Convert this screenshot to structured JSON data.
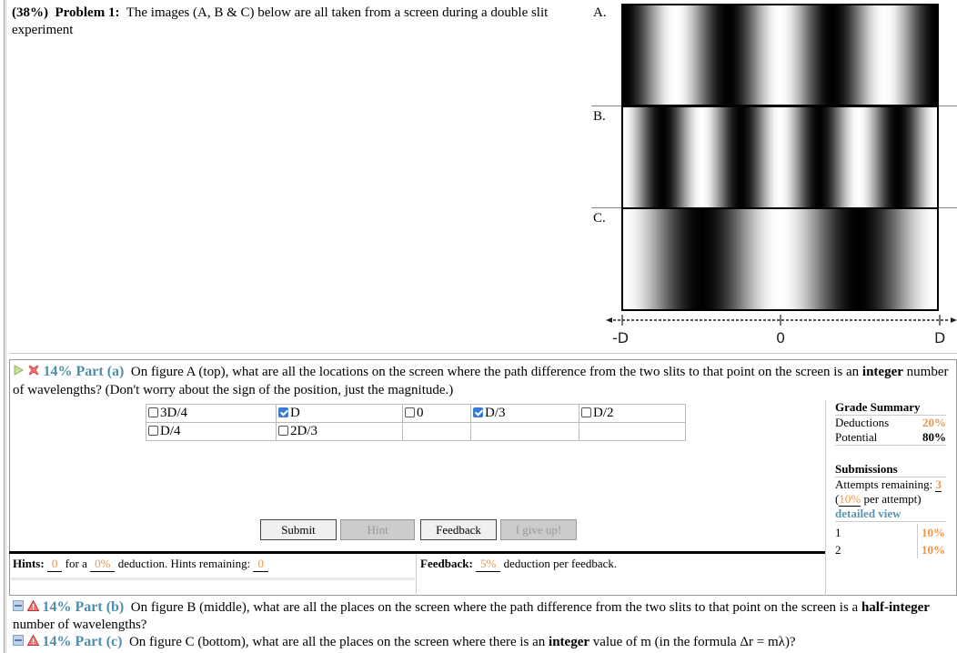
{
  "problem": {
    "percent": "(38%)",
    "title": "Problem 1:",
    "text": "The images (A, B & C) below are all taken from a screen during a double slit experiment"
  },
  "figure": {
    "labels": [
      "A.",
      "B.",
      "C."
    ],
    "axis_labels": [
      "-D",
      "0",
      "D"
    ]
  },
  "part_a": {
    "percent": "14% Part (a)",
    "text1": "On figure A (top), what are all the locations on the screen where the path difference from the two slits to that point on the screen is an",
    "bold": "integer",
    "text2": "number of wavelengths? (Don't worry about the sign of the position, just the magnitude.)",
    "status_icon": "x-mark-icon",
    "choices": [
      {
        "label": "3D/4",
        "checked": false
      },
      {
        "label": "D",
        "checked": true
      },
      {
        "label": "0",
        "checked": false
      },
      {
        "label": "D/3",
        "checked": true
      },
      {
        "label": "D/2",
        "checked": false
      },
      {
        "label": "D/4",
        "checked": false
      },
      {
        "label": "2D/3",
        "checked": false
      }
    ],
    "buttons": {
      "submit": "Submit",
      "hint": "Hint",
      "feedback": "Feedback",
      "give_up": "I give up!"
    },
    "hints": {
      "label": "Hints:",
      "count": "0",
      "mid": "for a",
      "deduction": "0%",
      "tail": "deduction. Hints remaining:",
      "remaining": "0"
    },
    "feedback": {
      "label": "Feedback:",
      "deduction": "5%",
      "tail": "deduction per feedback."
    }
  },
  "grade_summary": {
    "title": "Grade Summary",
    "deductions_label": "Deductions",
    "deductions_value": "20%",
    "potential_label": "Potential",
    "potential_value": "80%",
    "submissions_title": "Submissions",
    "attempts_label": "Attempts remaining:",
    "attempts_value": "3",
    "per_attempt_open": "(",
    "per_attempt_value": "10%",
    "per_attempt_tail": "per attempt)",
    "detailed_view": "detailed view",
    "history": [
      {
        "n": "1",
        "value": "10%"
      },
      {
        "n": "2",
        "value": "10%"
      }
    ]
  },
  "part_b": {
    "percent": "14% Part (b)",
    "text1": "On figure B (middle), what are all the places on the screen where the path difference from the two slits to that point on the screen is a",
    "bold": "half-integer",
    "text2": "number of wavelengths?"
  },
  "part_c": {
    "percent": "14% Part (c)",
    "text1": "On figure C (bottom), what are all the places on the screen where there is an",
    "bold": "integer",
    "text2": "value of m (in the formula Δr = mλ)?"
  }
}
